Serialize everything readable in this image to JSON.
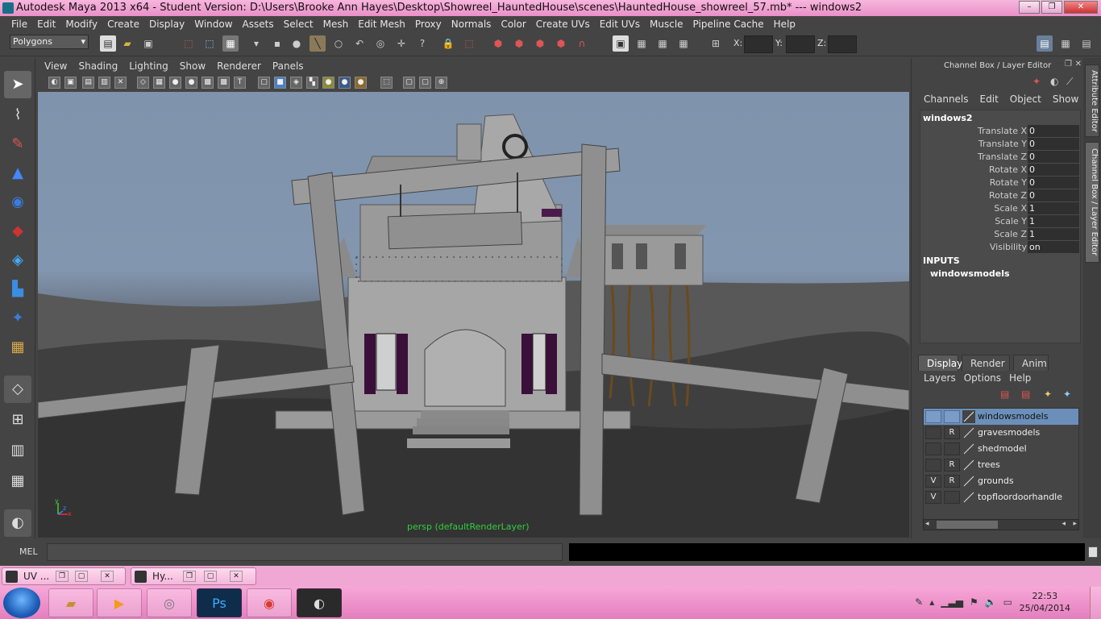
{
  "window": {
    "title": "Autodesk Maya 2013 x64 - Student Version: D:\\Users\\Brooke Ann Hayes\\Desktop\\Showreel_HauntedHouse\\scenes\\HauntedHouse_showreel_57.mb*   ---   windows2",
    "minimize": "–",
    "maximize": "❐",
    "close": "✕"
  },
  "menubar": [
    "File",
    "Edit",
    "Modify",
    "Create",
    "Display",
    "Window",
    "Assets",
    "Select",
    "Mesh",
    "Edit Mesh",
    "Proxy",
    "Normals",
    "Color",
    "Create UVs",
    "Edit UVs",
    "Muscle",
    "Pipeline Cache",
    "Help"
  ],
  "shelf": {
    "mode": "Polygons",
    "x_label": "X:",
    "y_label": "Y:",
    "z_label": "Z:"
  },
  "viewport": {
    "menus": [
      "View",
      "Shading",
      "Lighting",
      "Show",
      "Renderer",
      "Panels"
    ],
    "camera_label": "persp (defaultRenderLayer)",
    "axis_y": "y",
    "axis_x": "x",
    "axis_z": "z"
  },
  "channel_box": {
    "title": "Channel Box / Layer Editor",
    "menus": [
      "Channels",
      "Edit",
      "Object",
      "Show"
    ],
    "object": "windows2",
    "attributes": [
      {
        "name": "Translate X",
        "value": "0"
      },
      {
        "name": "Translate Y",
        "value": "0"
      },
      {
        "name": "Translate Z",
        "value": "0"
      },
      {
        "name": "Rotate X",
        "value": "0"
      },
      {
        "name": "Rotate Y",
        "value": "0"
      },
      {
        "name": "Rotate Z",
        "value": "0"
      },
      {
        "name": "Scale X",
        "value": "1"
      },
      {
        "name": "Scale Y",
        "value": "1"
      },
      {
        "name": "Scale Z",
        "value": "1"
      },
      {
        "name": "Visibility",
        "value": "on"
      }
    ],
    "inputs_label": "INPUTS",
    "inputs_item": "windowsmodels"
  },
  "side_tabs": [
    "Attribute Editor",
    "Channel Box / Layer Editor"
  ],
  "layer_editor": {
    "tabs": [
      "Display",
      "Render",
      "Anim"
    ],
    "menus": [
      "Layers",
      "Options",
      "Help"
    ],
    "layers": [
      {
        "v": "",
        "r": "",
        "name": "windowsmodels"
      },
      {
        "v": "",
        "r": "R",
        "name": "gravesmodels"
      },
      {
        "v": "",
        "r": "",
        "name": "shedmodel"
      },
      {
        "v": "",
        "r": "R",
        "name": "trees"
      },
      {
        "v": "V",
        "r": "R",
        "name": "grounds"
      },
      {
        "v": "V",
        "r": "",
        "name": "topfloordoorhandle"
      }
    ]
  },
  "command_line": {
    "label": "MEL"
  },
  "minimized_windows": [
    {
      "label": "UV ..."
    },
    {
      "label": "Hy..."
    }
  ],
  "taskbar": {
    "time": "22:53",
    "date": "25/04/2014"
  },
  "colors": {
    "titlebar": "#f0a7d4",
    "selection": "#6c8fb9",
    "camera_label": "#2fd03a",
    "maya_bg": "#444444"
  }
}
